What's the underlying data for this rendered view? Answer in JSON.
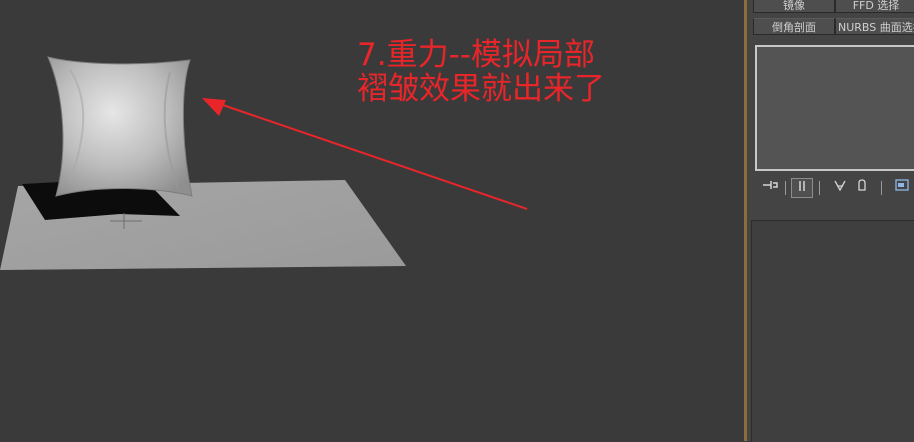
{
  "annotation": {
    "line1": "7.重力--模拟局部",
    "line2": "褶皱效果就出来了",
    "color": "#e8262a"
  },
  "modifier_buttons": {
    "mirror": "镜像",
    "ffd_select": "FFD 选择",
    "bevel_profile": "倒角剖面",
    "nurbs_surface_select": "NURBS 曲面选择"
  },
  "toolbar": {
    "icons": [
      "pin-stack-icon",
      "show-end-result-icon",
      "make-unique-icon",
      "remove-modifier-icon",
      "configure-modifier-sets-icon"
    ]
  },
  "colors": {
    "viewport_bg": "#3a3a3a",
    "panel_bg": "#444444",
    "divider": "#8a6f3a"
  }
}
